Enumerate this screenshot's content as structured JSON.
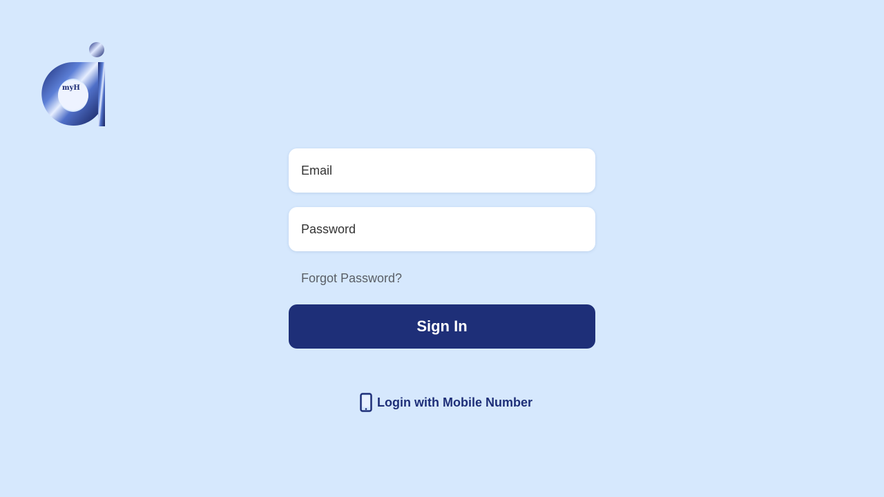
{
  "brand": {
    "logo_text": "myH",
    "logo_icon": "brand-logo"
  },
  "login_form": {
    "email_placeholder": "Email",
    "password_placeholder": "Password",
    "forgot_password_label": "Forgot Password?",
    "sign_in_label": "Sign In",
    "mobile_login_label": "Login with Mobile Number",
    "mobile_login_icon": "phone-icon"
  },
  "colors": {
    "background": "#d6e8fd",
    "primary": "#1e2f78",
    "field_background": "#ffffff"
  }
}
